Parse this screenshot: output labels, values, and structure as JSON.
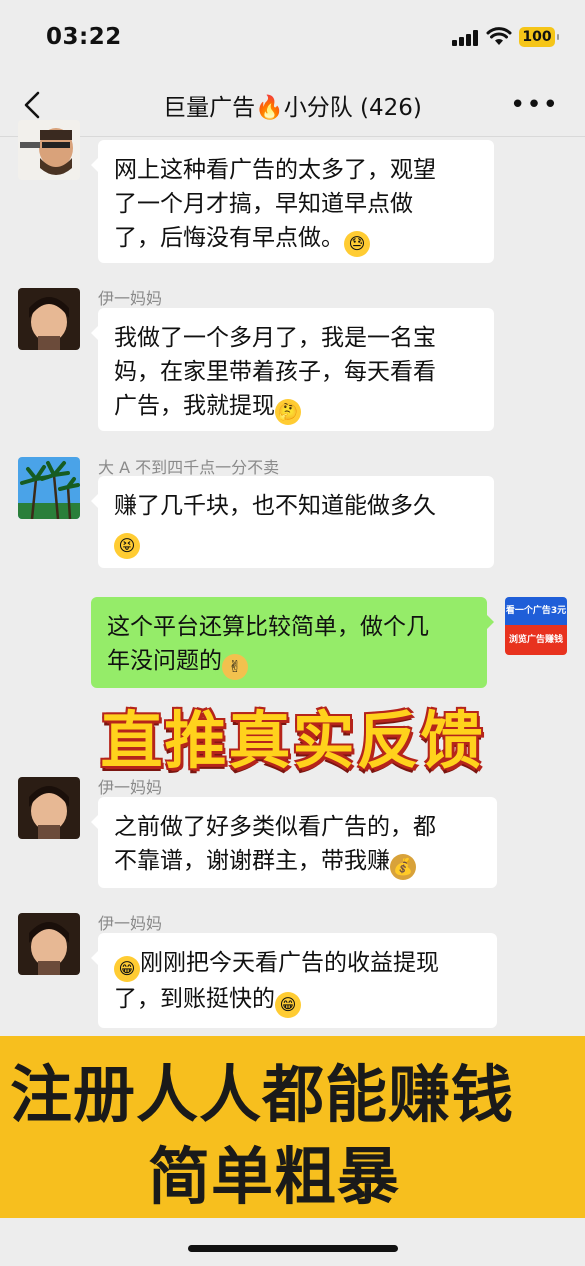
{
  "status": {
    "time": "03:22",
    "battery": "100"
  },
  "nav": {
    "title": "巨量广告🔥小分队 (426)",
    "more": "•••"
  },
  "messages": [
    {
      "sender": "",
      "line1": "网上这种看广告的太多了，观望",
      "line2": "了一个月才搞，早知道早点做",
      "line3": "了，后悔没有早点做。",
      "emoji": "😓"
    },
    {
      "sender": "伊一妈妈",
      "line1": "我做了一个多月了，我是一名宝",
      "line2": "妈，在家里带着孩子，每天看看",
      "line3": "广告，我就提现",
      "emoji": "🤔"
    },
    {
      "sender": "大 A 不到四千点一分不卖",
      "line1": "赚了几千块，也不知道能做多久",
      "line2": "",
      "emoji": "😝"
    },
    {
      "sender": "",
      "line1": "这个平台还算比较简单，做个几",
      "line2": "年没问题的",
      "emoji": "✌"
    },
    {
      "sender": "伊一妈妈",
      "line1": "之前做了好多类似看广告的，都",
      "line2": "不靠谱，谢谢群主，带我赚",
      "emoji": "💰"
    },
    {
      "sender": "伊一妈妈",
      "line1": "刚刚把今天看广告的收益提现",
      "line2": "了，到账挺快的",
      "emoji": "😁"
    }
  ],
  "ad_badge": {
    "top": "看一个广告3元",
    "bottom": "浏览广告赚钱"
  },
  "headline": "直推真实反馈",
  "banner": {
    "line1": "注册人人都能赚钱",
    "line2": "简单粗暴"
  }
}
